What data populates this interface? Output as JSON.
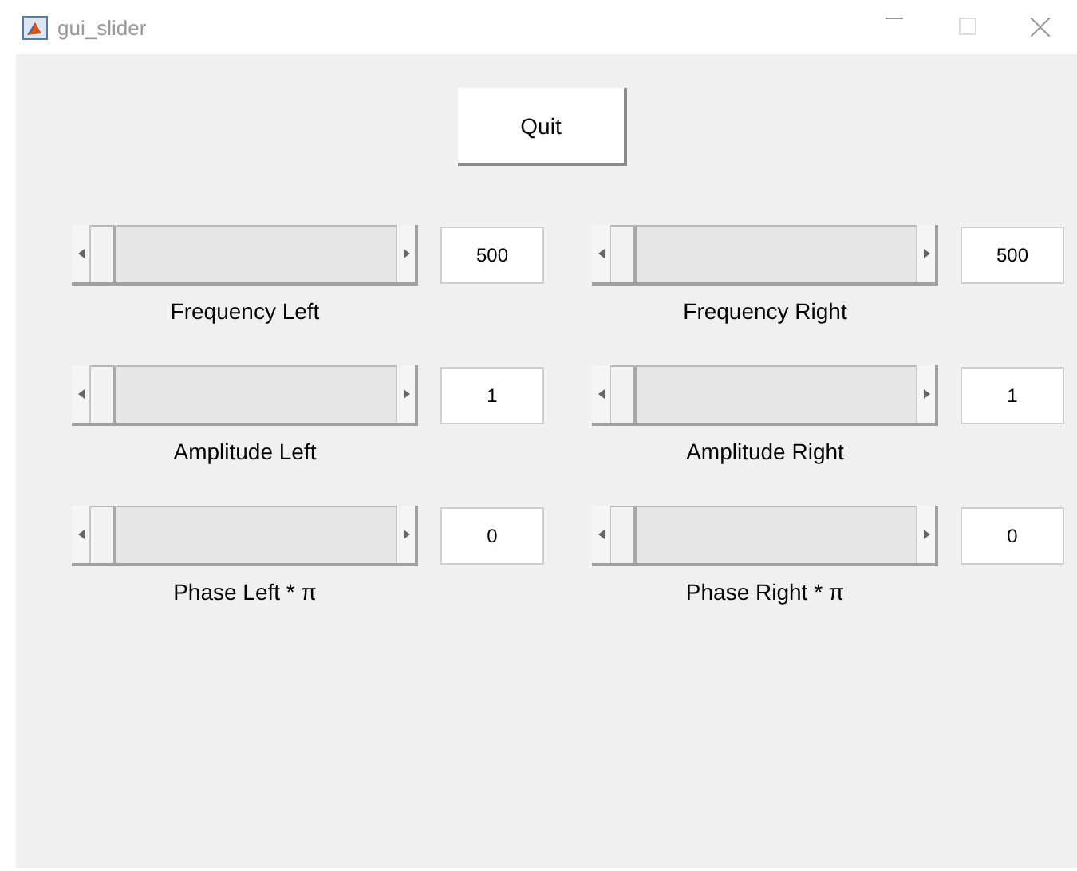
{
  "window": {
    "title": "gui_slider"
  },
  "quit_button": {
    "label": "Quit"
  },
  "controls": [
    {
      "label": "Frequency Left",
      "value": "500",
      "level": 0.0
    },
    {
      "label": "Frequency Right",
      "value": "500",
      "level": 0.0
    },
    {
      "label": "Amplitude Left",
      "value": "1",
      "level": 0.0
    },
    {
      "label": "Amplitude Right",
      "value": "1",
      "level": 0.0
    },
    {
      "label": "Phase Left * π",
      "value": "0",
      "level": 0.0
    },
    {
      "label": "Phase Right * π",
      "value": "0",
      "level": 0.0
    }
  ]
}
